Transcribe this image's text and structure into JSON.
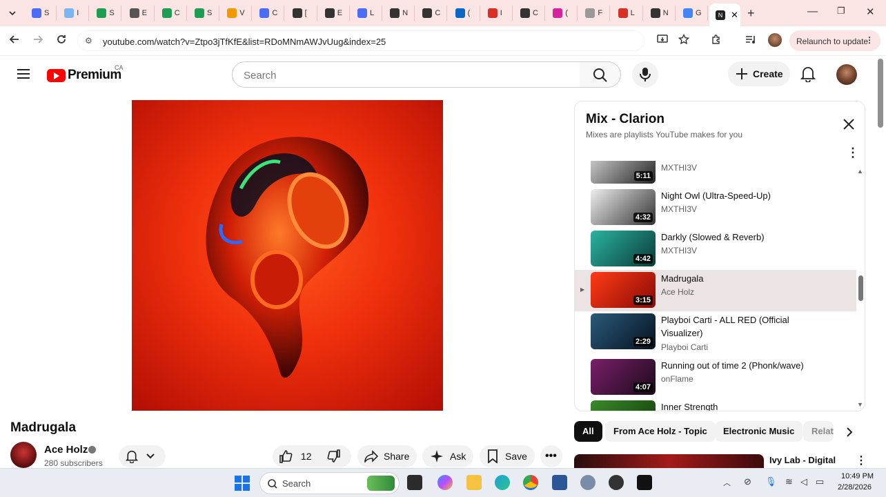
{
  "browser": {
    "tabs_inactive": [
      {
        "letter": "S",
        "color": "#4a6cf7"
      },
      {
        "letter": "I",
        "color": "#7ab6f0"
      },
      {
        "letter": "S",
        "color": "#1e9e53"
      },
      {
        "letter": "E",
        "color": "#555555"
      },
      {
        "letter": "C",
        "color": "#1e9e53"
      },
      {
        "letter": "S",
        "color": "#1e9e53"
      },
      {
        "letter": "V",
        "color": "#f29900"
      },
      {
        "letter": "C",
        "color": "#4a6cf7"
      },
      {
        "letter": "[",
        "color": "#333333"
      },
      {
        "letter": "E",
        "color": "#333333"
      },
      {
        "letter": "L",
        "color": "#4a6cf7"
      },
      {
        "letter": "N",
        "color": "#333333"
      },
      {
        "letter": "C",
        "color": "#333333"
      },
      {
        "letter": "(",
        "color": "#0a66c2"
      },
      {
        "letter": "I",
        "color": "#d93025"
      },
      {
        "letter": "C",
        "color": "#333333"
      },
      {
        "letter": "(",
        "color": "#d6249f"
      },
      {
        "letter": "F",
        "color": "#999999"
      },
      {
        "letter": "L",
        "color": "#d93025"
      },
      {
        "letter": "N",
        "color": "#333333"
      },
      {
        "letter": "G",
        "color": "#4285f4"
      }
    ],
    "active_tab_letter": "N",
    "url": "youtube.com/watch?v=Ztpo3jTfKfE&list=RDoMNmAWJvUug&index=25",
    "relaunch_label": "Relaunch to update"
  },
  "yt_header": {
    "logo_text": "Premium",
    "logo_region": "CA",
    "search_placeholder": "Search",
    "create_label": "Create"
  },
  "video": {
    "title": "Madrugala",
    "channel": "Ace Holz",
    "subscribers": "280 subscribers",
    "likes": "12",
    "share_label": "Share",
    "ask_label": "Ask",
    "save_label": "Save"
  },
  "playlist": {
    "title": "Mix - Clarion",
    "subtitle": "Mixes are playlists YouTube makes for you",
    "items": [
      {
        "title": "",
        "channel": "MXTHI3V",
        "duration": "5:11",
        "colors": [
          "#ddd",
          "#222"
        ]
      },
      {
        "title": "Night Owl (Ultra-Speed-Up)",
        "channel": "MXTHI3V",
        "duration": "4:32",
        "colors": [
          "#eee",
          "#333"
        ]
      },
      {
        "title": "Darkly (Slowed & Reverb)",
        "channel": "MXTHI3V",
        "duration": "4:42",
        "colors": [
          "#2bb3a3",
          "#0a3b36"
        ]
      },
      {
        "title": "Madrugala",
        "channel": "Ace Holz",
        "duration": "3:15",
        "colors": [
          "#ff3b16",
          "#8a0a05"
        ],
        "active": true
      },
      {
        "title": "Playboi Carti - ALL RED (Official Visualizer)",
        "channel": "Playboi Carti",
        "duration": "2:29",
        "colors": [
          "#2a5a7a",
          "#061220"
        ]
      },
      {
        "title": "Running out of time 2 (Phonk/wave)",
        "channel": "onFlame",
        "duration": "4:07",
        "colors": [
          "#7a1f6a",
          "#1b0a1a"
        ]
      },
      {
        "title": "Inner Strength",
        "channel": "",
        "duration": "",
        "colors": [
          "#3a8a2a",
          "#123a0a"
        ]
      }
    ]
  },
  "chips": [
    "All",
    "From Ace Holz - Topic",
    "Electronic Music",
    "Relat"
  ],
  "recommendation": {
    "title": "Ivy Lab - Digital"
  },
  "taskbar": {
    "search_placeholder": "Search",
    "time": "10:49 PM",
    "date": "2/28/2026"
  },
  "colors": {
    "yt_red": "#ff0000",
    "chrome_tint": "#fbe4e4"
  }
}
